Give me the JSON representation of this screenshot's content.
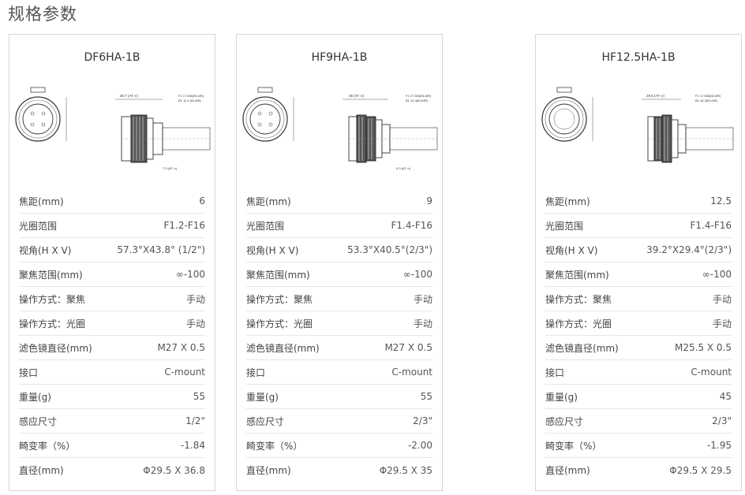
{
  "page": {
    "title": "规格参数"
  },
  "products": [
    {
      "name": "DF6HA-1B",
      "dims": {
        "top": "36.7 (AT ∞)",
        "len1": "7.3 (AT ∞)",
        "f1": "F1  17.526(IN AIR)",
        "b1": "B1  11.4 (IN AIR)",
        "d1": "Φ29.5",
        "d2": "Φ27.5",
        "d3": "Φ17.8",
        "d4": "Φ25.5",
        "d5": "5.2",
        "d6": "3",
        "d7": "5"
      },
      "specs": [
        {
          "label": "焦距(mm)",
          "value": "6"
        },
        {
          "label": "光圈范围",
          "value": "F1.2-F16"
        },
        {
          "label": "视角(H X V)",
          "value": "57.3°X43.8° (1/2\")"
        },
        {
          "label": "聚焦范围(mm)",
          "value": "∞-100"
        },
        {
          "label": "操作方式：聚焦",
          "value": "手动"
        },
        {
          "label": "操作方式：光圈",
          "value": "手动"
        },
        {
          "label": "滤色镜直径(mm)",
          "value": "M27 X 0.5"
        },
        {
          "label": "接口",
          "value": "C-mount"
        },
        {
          "label": "重量(g)",
          "value": "55"
        },
        {
          "label": "感应尺寸",
          "value": "1/2\""
        },
        {
          "label": "畸变率（%）",
          "value": "-1.84"
        },
        {
          "label": "直径(mm)",
          "value": "Φ29.5 X 36.8"
        }
      ]
    },
    {
      "name": "HF9HA-1B",
      "dims": {
        "top": "35 (AT ∞)",
        "len1": "5.3 (AT ∞)",
        "f1": "F1  17.526(IN AIR)",
        "b1": "B1  13.4(IN AIR)",
        "d1": "Φ29.5",
        "d2": "Φ27.5",
        "d3": "Φ17.8",
        "d4": "Φ25.5",
        "d5": "3.8",
        "d6": "10",
        "d7": "3"
      },
      "specs": [
        {
          "label": "焦距(mm)",
          "value": "9"
        },
        {
          "label": "光圈范围",
          "value": "F1.4-F16"
        },
        {
          "label": "视角(H X V)",
          "value": "53.3°X40.5°(2/3\")"
        },
        {
          "label": "聚焦范围(mm)",
          "value": "∞-100"
        },
        {
          "label": "操作方式：聚焦",
          "value": "手动"
        },
        {
          "label": "操作方式：光圈",
          "value": "手动"
        },
        {
          "label": "滤色镜直径(mm)",
          "value": "M27 X 0.5"
        },
        {
          "label": "接口",
          "value": "C-mount"
        },
        {
          "label": "重量(g)",
          "value": "55"
        },
        {
          "label": "感应尺寸",
          "value": "2/3\""
        },
        {
          "label": "畸变率（%）",
          "value": "-2.00"
        },
        {
          "label": "直径(mm)",
          "value": "Φ29.5 X 35"
        }
      ]
    },
    {
      "name": "HF12.5HA-1B",
      "dims": {
        "top": "29.5 (AT ∞)",
        "len1": "",
        "f1": "F1  17.526(IN AIR)",
        "b1": "B1  15.2(IN AIR)",
        "d1": "Φ29.5",
        "d2": "Φ25.5",
        "d3": "",
        "d4": "5.3",
        "d5": "",
        "d6": "10",
        "d7": "3"
      },
      "specs": [
        {
          "label": "焦距(mm)",
          "value": "12.5"
        },
        {
          "label": "光圈范围",
          "value": "F1.4-F16"
        },
        {
          "label": "视角(H X V)",
          "value": "39.2°X29.4°(2/3\")"
        },
        {
          "label": "聚焦范围(mm)",
          "value": "∞-100"
        },
        {
          "label": "操作方式：聚焦",
          "value": "手动"
        },
        {
          "label": "操作方式：光圈",
          "value": "手动"
        },
        {
          "label": "滤色镜直径(mm)",
          "value": "M25.5 X 0.5"
        },
        {
          "label": "接口",
          "value": "C-mount"
        },
        {
          "label": "重量(g)",
          "value": "45"
        },
        {
          "label": "感应尺寸",
          "value": "2/3\""
        },
        {
          "label": "畸变率（%）",
          "value": "-1.95"
        },
        {
          "label": "直径(mm)",
          "value": "Φ29.5 X 29.5"
        }
      ]
    }
  ]
}
